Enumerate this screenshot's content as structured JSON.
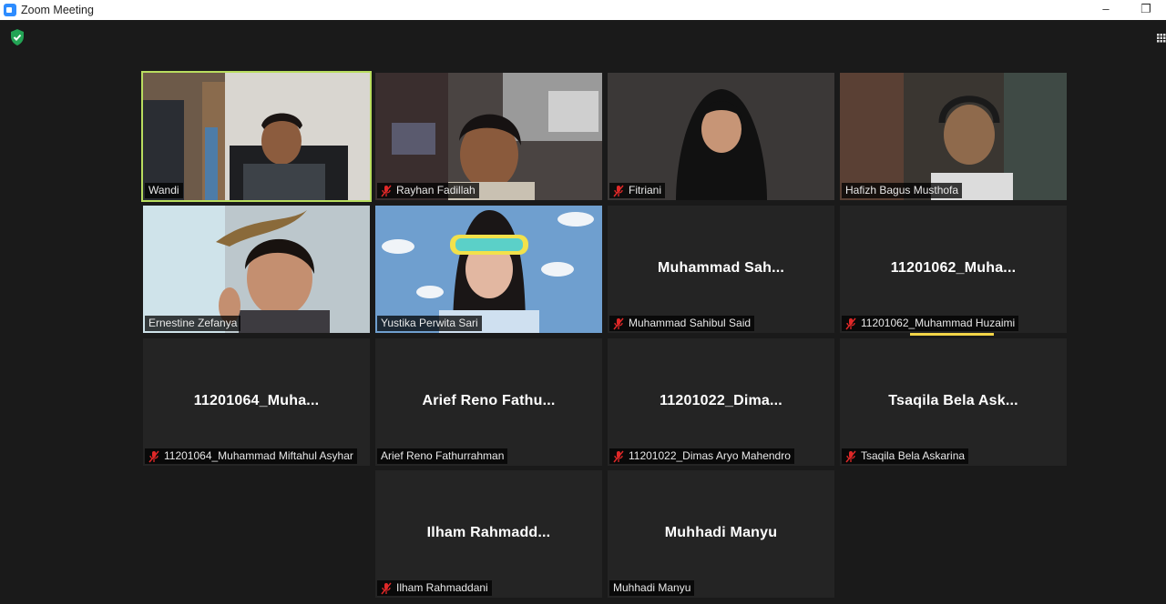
{
  "window": {
    "title": "Zoom Meeting",
    "minimize": "–",
    "restore": "❐"
  },
  "icons": {
    "security": "shield-check-icon",
    "view": "gallery-view-icon",
    "mute": "mic-muted-icon",
    "accent": "#b9dd5f",
    "muted_color": "#e02828"
  },
  "participants": [
    {
      "label": "Wandi",
      "muted": false,
      "video": true,
      "active": true
    },
    {
      "label": "Rayhan Fadillah",
      "muted": true,
      "video": true
    },
    {
      "label": "Fitriani",
      "muted": true,
      "video": true
    },
    {
      "label": "Hafizh Bagus Musthofa",
      "muted": false,
      "video": true
    },
    {
      "label": "Ernestine Zefanya",
      "muted": false,
      "video": true
    },
    {
      "label": "Yustika Perwita Sari",
      "muted": false,
      "video": true
    },
    {
      "label": "Muhammad Sahibul Said",
      "center": "Muhammad  Sah...",
      "muted": true,
      "video": false
    },
    {
      "label": "11201062_Muhammad Huzaimi",
      "center": "11201062_Muha...",
      "muted": true,
      "video": false
    },
    {
      "label": "11201064_Muhammad Miftahul Asyhar",
      "center": "11201064_Muha...",
      "muted": true,
      "video": false
    },
    {
      "label": "Arief Reno Fathurrahman",
      "center": "Arief  Reno  Fathu...",
      "muted": false,
      "video": false
    },
    {
      "label": "11201022_Dimas Aryo Mahendro",
      "center": "11201022_Dima...",
      "muted": true,
      "video": false
    },
    {
      "label": "Tsaqila Bela Askarina",
      "center": "Tsaqila  Bela  Ask...",
      "muted": true,
      "video": false
    },
    {
      "label": "Ilham Rahmaddani",
      "center": "Ilham  Rahmadd...",
      "muted": true,
      "video": false
    },
    {
      "label": "Muhhadi Manyu",
      "center": "Muhhadi Manyu",
      "muted": false,
      "video": false
    }
  ]
}
